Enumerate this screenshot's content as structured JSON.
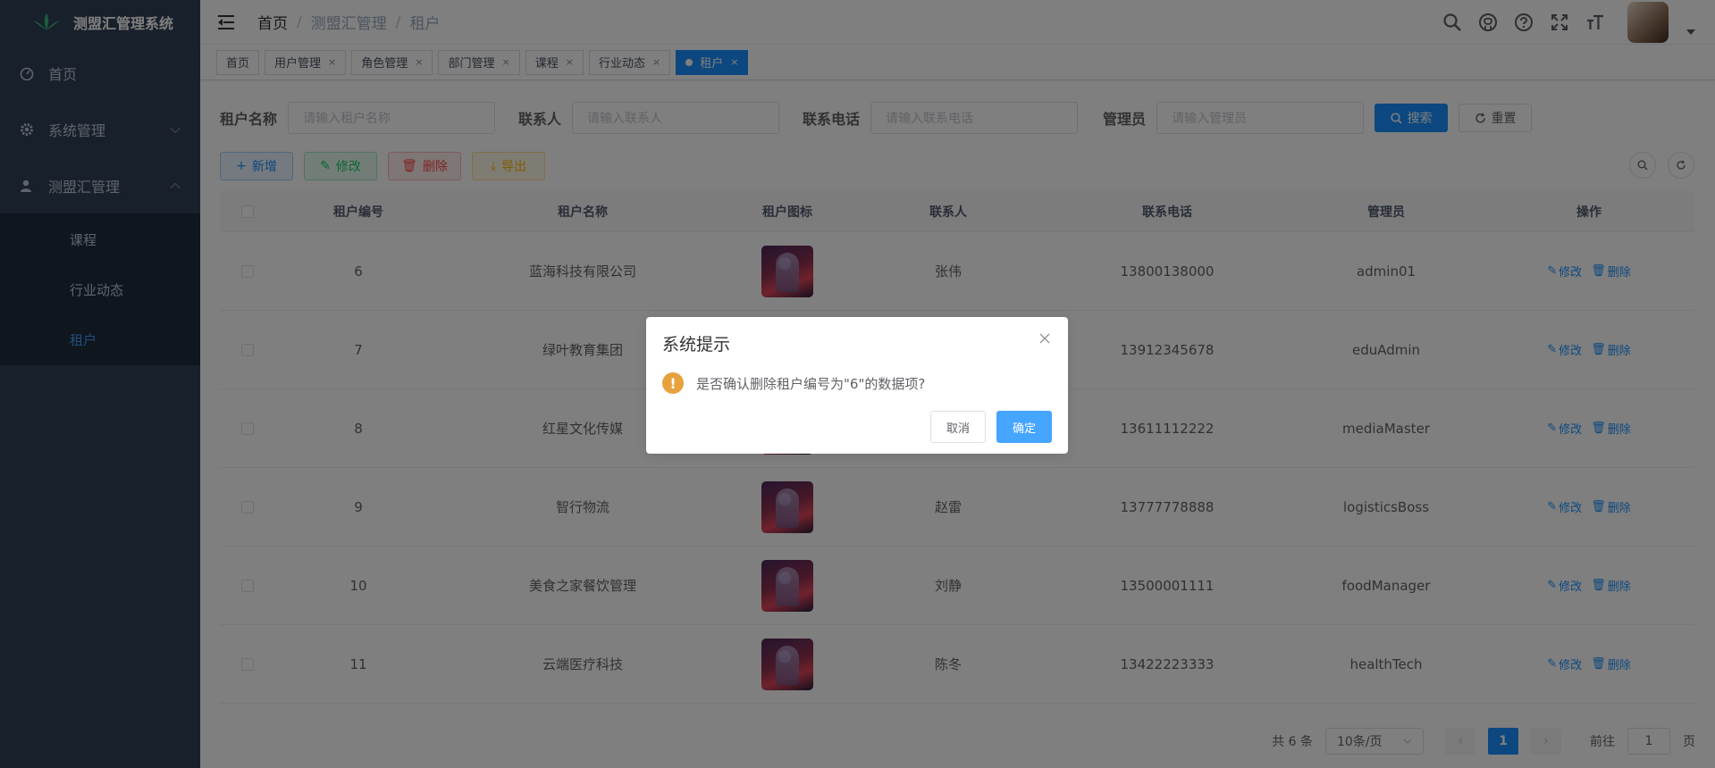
{
  "app": {
    "title": "测盟汇管理系统"
  },
  "sidebar": {
    "items": [
      {
        "label": "首页",
        "icon": "dashboard-icon"
      },
      {
        "label": "系统管理",
        "icon": "gear-icon"
      },
      {
        "label": "测盟汇管理",
        "icon": "user-icon"
      }
    ],
    "submenu": [
      {
        "label": "课程"
      },
      {
        "label": "行业动态"
      },
      {
        "label": "租户",
        "active": true
      }
    ]
  },
  "breadcrumb": [
    "首页",
    "测盟汇管理",
    "租户"
  ],
  "tags": [
    {
      "label": "首页",
      "closable": false
    },
    {
      "label": "用户管理",
      "closable": true
    },
    {
      "label": "角色管理",
      "closable": true
    },
    {
      "label": "部门管理",
      "closable": true
    },
    {
      "label": "课程",
      "closable": true
    },
    {
      "label": "行业动态",
      "closable": true
    },
    {
      "label": "租户",
      "closable": true,
      "active": true
    }
  ],
  "search": {
    "fields": [
      {
        "label": "租户名称",
        "placeholder": "请输入租户名称"
      },
      {
        "label": "联系人",
        "placeholder": "请输入联系人"
      },
      {
        "label": "联系电话",
        "placeholder": "请输入联系电话"
      },
      {
        "label": "管理员",
        "placeholder": "请输入管理员"
      }
    ],
    "search_label": "搜索",
    "reset_label": "重置"
  },
  "toolbar": {
    "add": "新增",
    "edit": "修改",
    "delete": "删除",
    "export": "导出"
  },
  "table": {
    "columns": [
      "租户编号",
      "租户名称",
      "租户图标",
      "联系人",
      "联系电话",
      "管理员",
      "操作"
    ],
    "rows": [
      {
        "id": "6",
        "name": "蓝海科技有限公司",
        "contact": "张伟",
        "phone": "13800138000",
        "admin": "admin01"
      },
      {
        "id": "7",
        "name": "绿叶教育集团",
        "contact": "",
        "phone": "13912345678",
        "admin": "eduAdmin"
      },
      {
        "id": "8",
        "name": "红星文化传媒",
        "contact": "",
        "phone": "13611112222",
        "admin": "mediaMaster"
      },
      {
        "id": "9",
        "name": "智行物流",
        "contact": "赵雷",
        "phone": "13777778888",
        "admin": "logisticsBoss"
      },
      {
        "id": "10",
        "name": "美食之家餐饮管理",
        "contact": "刘静",
        "phone": "13500001111",
        "admin": "foodManager"
      },
      {
        "id": "11",
        "name": "云端医疗科技",
        "contact": "陈冬",
        "phone": "13422223333",
        "admin": "healthTech"
      }
    ],
    "op_edit": "修改",
    "op_delete": "删除"
  },
  "pagination": {
    "total": "共 6 条",
    "page_size": "10条/页",
    "current": "1",
    "goto_label": "前往",
    "goto_value": "1",
    "page_unit": "页"
  },
  "dialog": {
    "title": "系统提示",
    "message": "是否确认删除租户编号为\"6\"的数据项?",
    "cancel": "取消",
    "confirm": "确定"
  },
  "colors": {
    "primary": "#1890ff",
    "sidebar": "#304156",
    "submenu": "#1f2d3d",
    "warning": "#e6a23c"
  }
}
